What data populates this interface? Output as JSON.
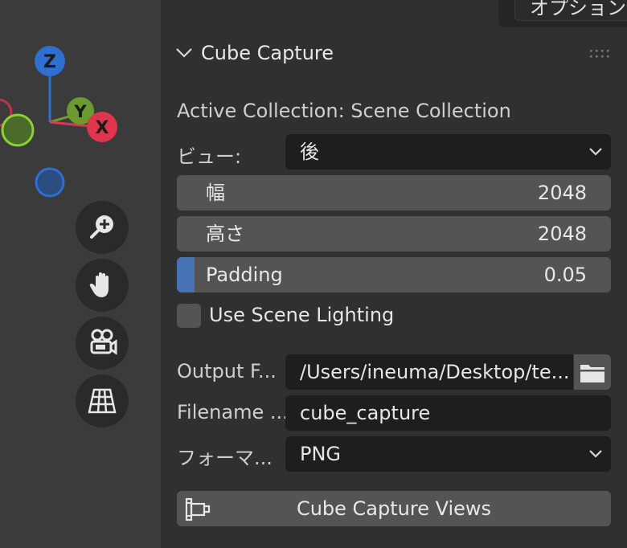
{
  "header": {
    "options_label": "オプション"
  },
  "gizmo": {
    "z_label": "Z",
    "y_label": "Y",
    "x_label": "X"
  },
  "nav_icons": [
    "zoom-icon",
    "hand-pan-icon",
    "camera-icon",
    "grid-icon"
  ],
  "panel": {
    "title": "Cube Capture",
    "active_collection": "Active Collection: Scene Collection",
    "view_label": "ビュー:",
    "view_value": "後",
    "width_label": "幅",
    "width_value": "2048",
    "height_label": "高さ",
    "height_value": "2048",
    "padding_label": "Padding",
    "padding_value": "0.05",
    "use_scene_lighting": "Use Scene Lighting",
    "output_label": "Output F...",
    "output_value": "/Users/ineuma/Desktop/te...",
    "filename_label": "Filename ...",
    "filename_value": "cube_capture",
    "format_label": "フォーマ...",
    "format_value": "PNG",
    "capture_button": "Cube Capture Views"
  },
  "colors": {
    "accent": "#4772b3",
    "z_axis": "#2e6fd1",
    "y_axis": "#6b9a2e",
    "x_axis": "#e0354e"
  }
}
